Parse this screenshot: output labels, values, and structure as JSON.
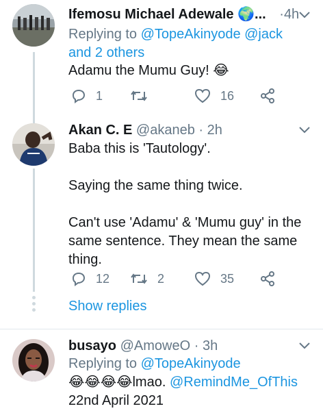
{
  "tweets": [
    {
      "name": "Ifemosu Michael Adewale",
      "name_suffix": " 🌍...",
      "handle": "",
      "time": "4h",
      "reply_prefix": "Replying to ",
      "reply_targets": "@TopeAkinyode @jack and 2 others",
      "text": "Adamu the Mumu Guy! 😂",
      "replies": "1",
      "retweets": "",
      "likes": "16"
    },
    {
      "name": "Akan C. E",
      "handle": "@akaneb",
      "time": "2h",
      "text_lines": [
        "Baba this is 'Tautology'.",
        "",
        "Saying the same thing twice.",
        "",
        "Can't use 'Adamu' & 'Mumu guy' in the",
        "same sentence. They mean the same",
        "thing."
      ],
      "replies": "12",
      "retweets": "2",
      "likes": "35"
    },
    {
      "name": "busayo",
      "handle": "@AmoweO",
      "time": "3h",
      "reply_prefix": "Replying to ",
      "reply_targets": "@TopeAkinyode",
      "text_emoji": "😂😂😂😂",
      "text_plain": "lmao. ",
      "text_mention": "@RemindMe_OfThis",
      "text_line2": "22nd April 2021"
    }
  ],
  "show_replies": "Show replies",
  "separator_dot": "·",
  "colors": {
    "link": "#1b95e0",
    "muted": "#657786",
    "divider": "#e1e8ed"
  },
  "icons": [
    "reply-icon",
    "retweet-icon",
    "like-icon",
    "share-icon",
    "chevron-down-icon"
  ]
}
